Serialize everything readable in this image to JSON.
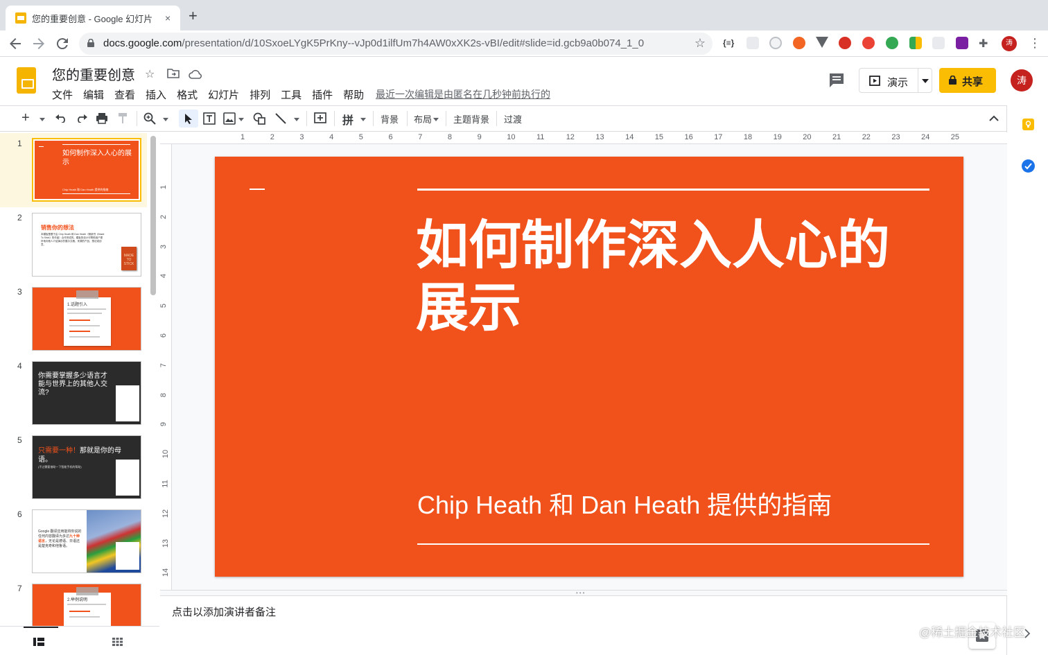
{
  "browser": {
    "tab_title": "您的重要创意 - Google 幻灯片",
    "tab_close": "×",
    "new_tab": "+",
    "url_host": "docs.google.com",
    "url_path": "/presentation/d/10SxoeLYgK5PrKny--vJp0d1ilfUm7h4AW0xXK2s-vBI/edit#slide=id.gcb9a0b074_1_0"
  },
  "app": {
    "doc_title": "您的重要创意",
    "menus": [
      "文件",
      "编辑",
      "查看",
      "插入",
      "格式",
      "幻灯片",
      "排列",
      "工具",
      "插件",
      "帮助"
    ],
    "last_edit": "最近一次编辑是由匿名在几秒钟前执行的",
    "present_label": "演示",
    "share_label": "共享",
    "avatar_letter": "涛"
  },
  "toolbar": {
    "input_tool": "拼",
    "background": "背景",
    "layout": "布局",
    "theme": "主题背景",
    "transition": "过渡"
  },
  "ruler": {
    "h_ticks": [
      "1",
      "2",
      "3",
      "4",
      "5",
      "6",
      "7",
      "8",
      "9",
      "10",
      "11",
      "12",
      "13",
      "14",
      "15",
      "16",
      "17",
      "18",
      "19",
      "20",
      "21",
      "22",
      "23",
      "24",
      "25"
    ],
    "v_ticks": [
      "1",
      "2",
      "3",
      "4",
      "5",
      "6",
      "7",
      "8",
      "9",
      "10",
      "11",
      "12",
      "13",
      "14"
    ]
  },
  "slide": {
    "title": "如何制作深入人心的展示",
    "subtitle": "Chip Heath 和 Dan Heath 提供的指南",
    "accent_color": "#f1511b"
  },
  "filmstrip": [
    {
      "num": "1",
      "title": "如何制作深入人心的展示",
      "sub": "Chip Heath 和 Dan Heath 提供的指南"
    },
    {
      "num": "2",
      "title": "销售你的想法",
      "body": "本模板是基于由 Chip Heath 和 Dan Heath（畅销书《Made To Stick》的作者）合作完成的。模板的设计可帮助用户更好地向他人介绍演示的展示文稿、来源的产品、想法或创意。",
      "book": "MADE TO STICK"
    },
    {
      "num": "3",
      "title": "1.话题引入"
    },
    {
      "num": "4",
      "title": "你需要掌握多少语言才能与世界上的其他人交流?"
    },
    {
      "num": "5",
      "title_accent": "只需要一种！",
      "title": "那就是你的母语。",
      "sub": "(不过需要借助一下智能手机的帮助)"
    },
    {
      "num": "6",
      "body_a": "Google 翻译应用能将你说的任何内容翻译为多达",
      "body_accent": "九十种语言",
      "body_b": "，无论是德语、日语还是楚克奇和他鲁语。"
    },
    {
      "num": "7",
      "title": "2.举例说明"
    }
  ],
  "notes_placeholder": "点击以添加演讲者备注",
  "watermark": "@稀土掘金技术社区"
}
